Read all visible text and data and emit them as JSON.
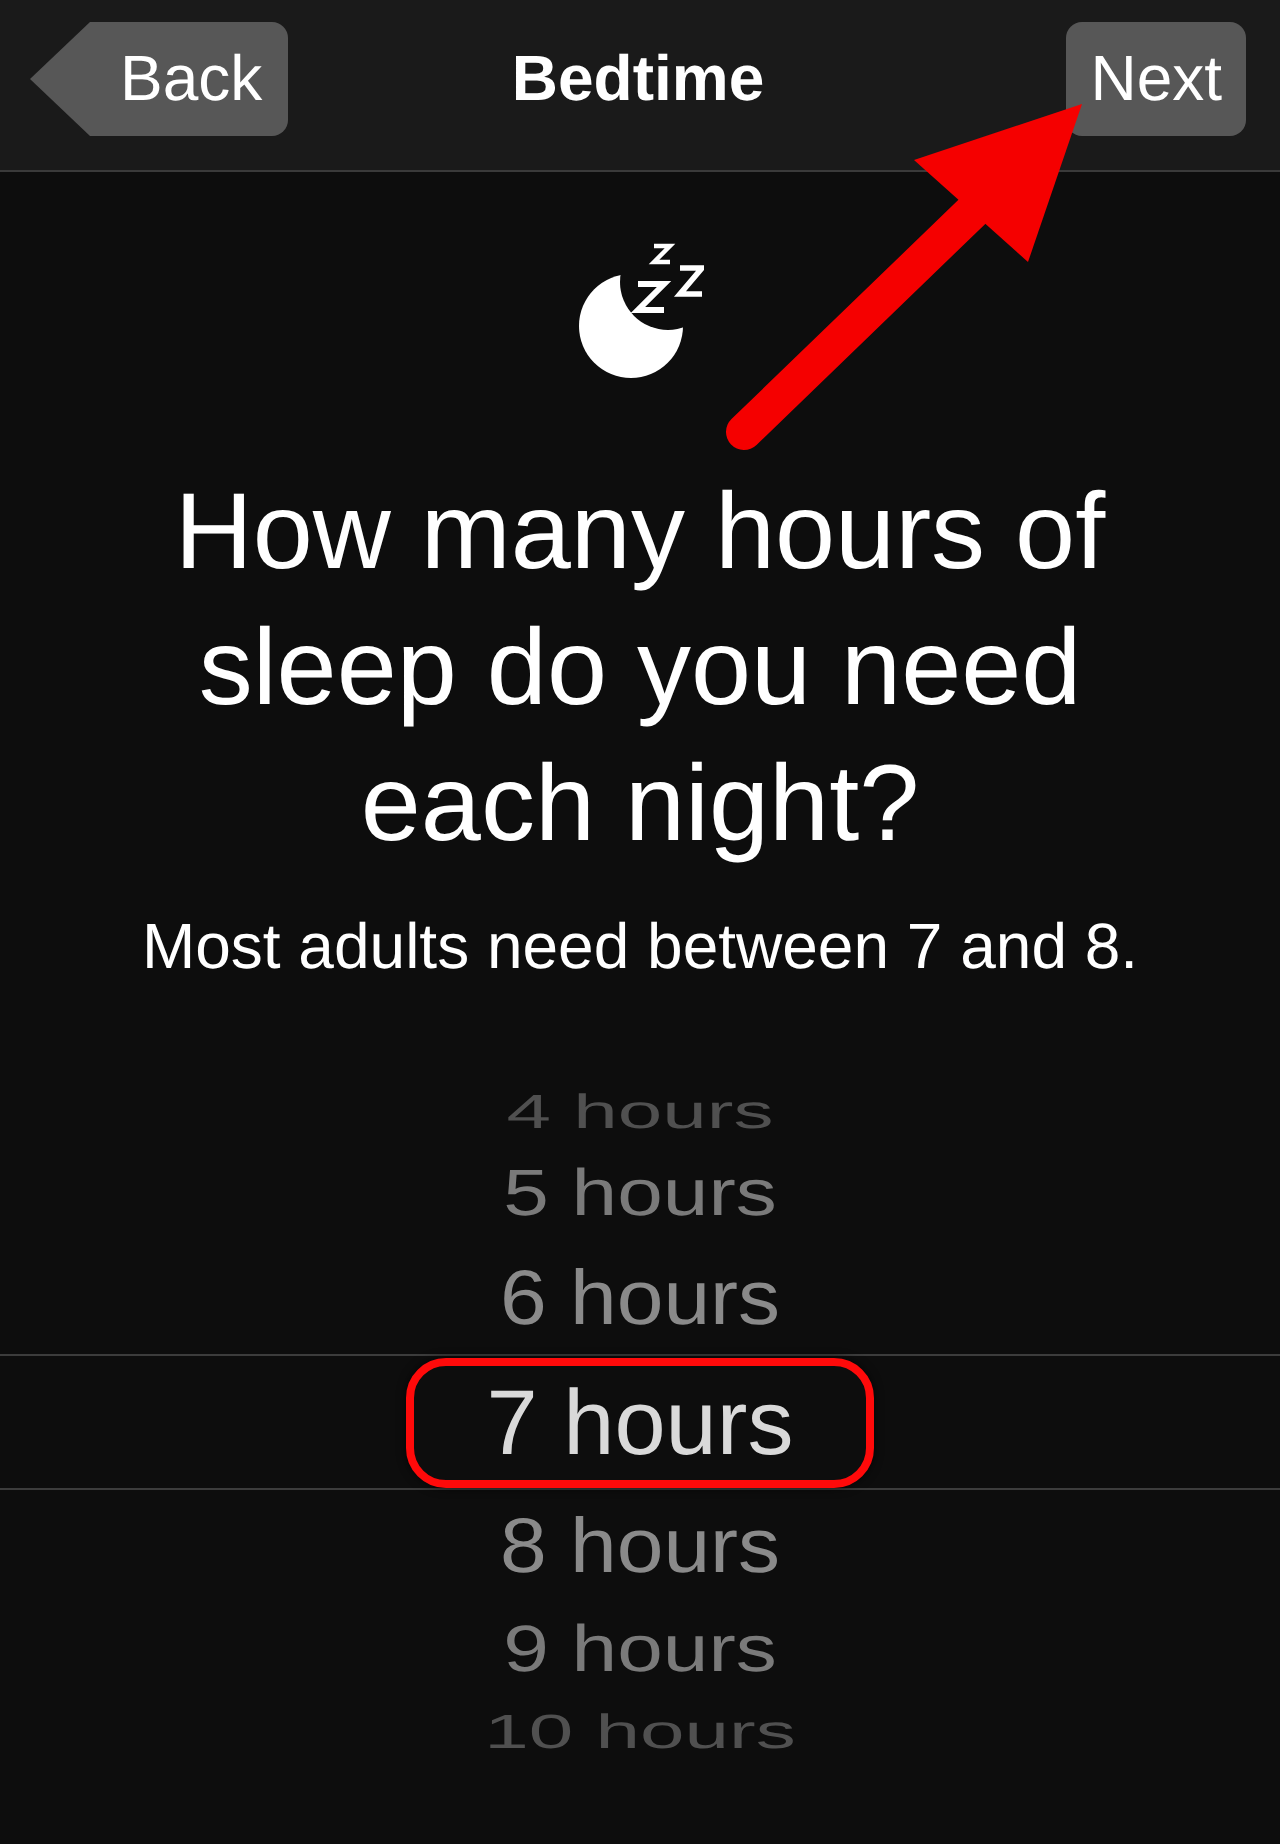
{
  "nav_bar": {
    "back_button": {
      "label": "Back"
    },
    "title": "Bedtime",
    "next_button": {
      "label": "Next",
      "arrow_callout": true
    }
  },
  "prompt": {
    "heading": "How many hours of sleep do you need each night?",
    "subtitle": "Most adults need between 7 and 8."
  },
  "picker": {
    "items": [
      {
        "label": "4 hours",
        "selected": false,
        "outlined": false
      },
      {
        "label": "5 hours",
        "selected": false,
        "outlined": false
      },
      {
        "label": "6 hours",
        "selected": false,
        "outlined": false
      },
      {
        "label": "7 hours",
        "selected": true,
        "outlined": true
      },
      {
        "label": "8 hours",
        "selected": false,
        "outlined": false
      },
      {
        "label": "9 hours",
        "selected": false,
        "outlined": false
      },
      {
        "label": "10 hours",
        "selected": false,
        "outlined": false
      }
    ]
  }
}
